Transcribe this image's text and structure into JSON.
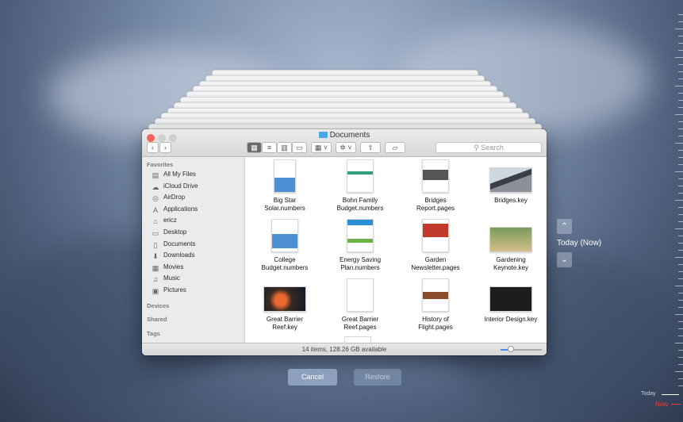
{
  "window": {
    "title": "Documents",
    "search_placeholder": "Search",
    "status": "14 items, 128.26 GB available"
  },
  "toolbar": {
    "back_icon": "chevron-left-icon",
    "forward_icon": "chevron-right-icon",
    "view_modes": [
      "icon-view-icon",
      "list-view-icon",
      "column-view-icon",
      "cover-flow-icon"
    ],
    "arrange_icon": "arrange-icon",
    "action_icon": "gear-icon",
    "share_icon": "share-icon",
    "tag_icon": "tag-icon"
  },
  "sidebar": {
    "favorites_label": "Favorites",
    "items": [
      {
        "label": "All My Files",
        "icon": "all-files-icon"
      },
      {
        "label": "iCloud Drive",
        "icon": "cloud-icon"
      },
      {
        "label": "AirDrop",
        "icon": "airdrop-icon"
      },
      {
        "label": "Applications",
        "icon": "applications-icon"
      },
      {
        "label": "ericz",
        "icon": "home-icon"
      },
      {
        "label": "Desktop",
        "icon": "desktop-icon"
      },
      {
        "label": "Documents",
        "icon": "documents-icon"
      },
      {
        "label": "Downloads",
        "icon": "downloads-icon"
      },
      {
        "label": "Movies",
        "icon": "movies-icon"
      },
      {
        "label": "Music",
        "icon": "music-icon"
      },
      {
        "label": "Pictures",
        "icon": "pictures-icon"
      }
    ],
    "devices_label": "Devices",
    "shared_label": "Shared",
    "tags_label": "Tags"
  },
  "files": [
    {
      "line1": "Big Star",
      "line2": "Solar.numbers"
    },
    {
      "line1": "Bohn Family",
      "line2": "Budget.numbers"
    },
    {
      "line1": "Bridges",
      "line2": "Report.pages"
    },
    {
      "line1": "Bridges.key",
      "line2": ""
    },
    {
      "line1": "College",
      "line2": "Budget.numbers"
    },
    {
      "line1": "Energy Saving",
      "line2": "Plan.numbers"
    },
    {
      "line1": "Garden",
      "line2": "Newsletter.pages"
    },
    {
      "line1": "Gardening",
      "line2": "Keynote.key"
    },
    {
      "line1": "Great Barrier",
      "line2": "Reef.key"
    },
    {
      "line1": "Great Barrier",
      "line2": "Reef.pages"
    },
    {
      "line1": "History of",
      "line2": "Flight.pages"
    },
    {
      "line1": "Interior Design.key",
      "line2": ""
    }
  ],
  "time_machine": {
    "cancel": "Cancel",
    "restore": "Restore",
    "current_label": "Today (Now)",
    "timeline_today": "Today",
    "timeline_now": "Now"
  },
  "colors": {
    "close": "#fc605c",
    "minimize": "#cfcfcf",
    "zoom": "#cfcfcf",
    "now_marker": "#ff3b30",
    "slider_accent": "#3f8ef4"
  }
}
